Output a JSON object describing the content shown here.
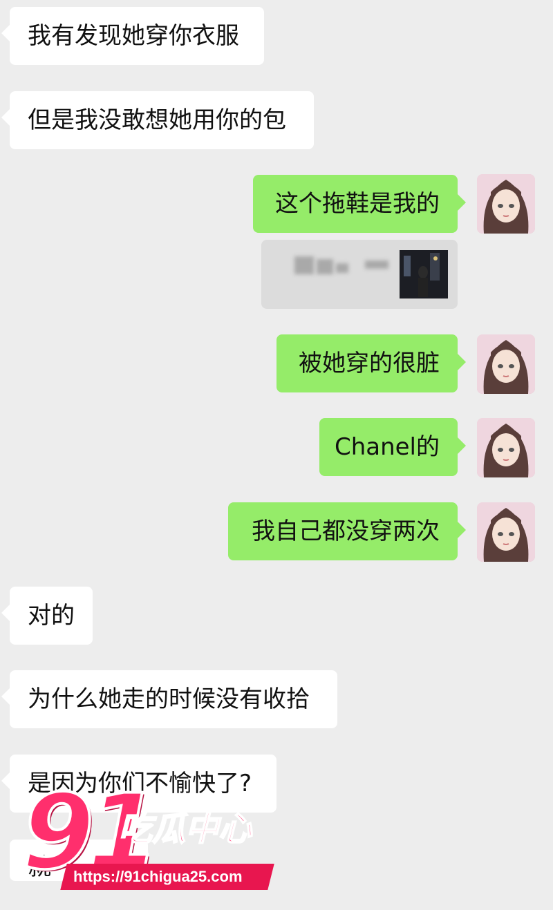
{
  "messages": [
    {
      "side": "left",
      "text": "我有发现她穿你衣服"
    },
    {
      "side": "left",
      "text": "但是我没敢想她用你的包"
    },
    {
      "side": "right",
      "text": "这个拖鞋是我的"
    },
    {
      "side": "right",
      "text": "被她穿的很脏"
    },
    {
      "side": "right",
      "text": "Chanel的"
    },
    {
      "side": "right",
      "text": "我自己都没穿两次"
    },
    {
      "side": "left",
      "text": "对的"
    },
    {
      "side": "left",
      "text": "为什么她走的时候没有收拾"
    },
    {
      "side": "left",
      "text": "是因为你们不愉快了?"
    },
    {
      "side": "left",
      "text": "就"
    }
  ],
  "quoted_message": {
    "type": "blurred-quote-with-thumbnail"
  },
  "watermark": {
    "number": "91",
    "title": "吃瓜中心",
    "url": "https://91chigua25.com"
  },
  "colors": {
    "background": "#ededed",
    "incoming_bubble": "#ffffff",
    "outgoing_bubble": "#95ec69",
    "watermark_pink": "#ff2f6d"
  }
}
